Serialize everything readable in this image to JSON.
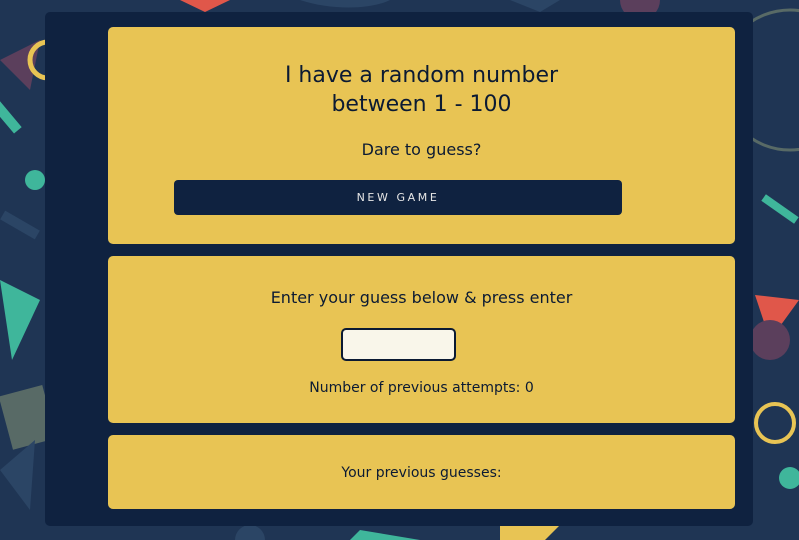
{
  "game": {
    "title_line1": "I have a random number",
    "title_line2": "between 1 - 100",
    "subtitle": "Dare to guess?",
    "new_game_label": "NEW GAME"
  },
  "guess": {
    "prompt": "Enter your guess below & press enter",
    "input_value": "",
    "attempts_label": "Number of previous attempts:",
    "attempts_count": "0"
  },
  "history": {
    "label": "Your previous guesses:",
    "guesses": ""
  },
  "colors": {
    "background": "#1f3554",
    "panel": "#0f2240",
    "card": "#e8c454",
    "text": "#0b1a33",
    "input": "#f9f6ea",
    "shape_teal": "#3fb69b",
    "shape_red": "#e0574a",
    "shape_yellow": "#e8c454",
    "shape_purple": "#5b3f5c",
    "shape_gray": "#586a66"
  }
}
